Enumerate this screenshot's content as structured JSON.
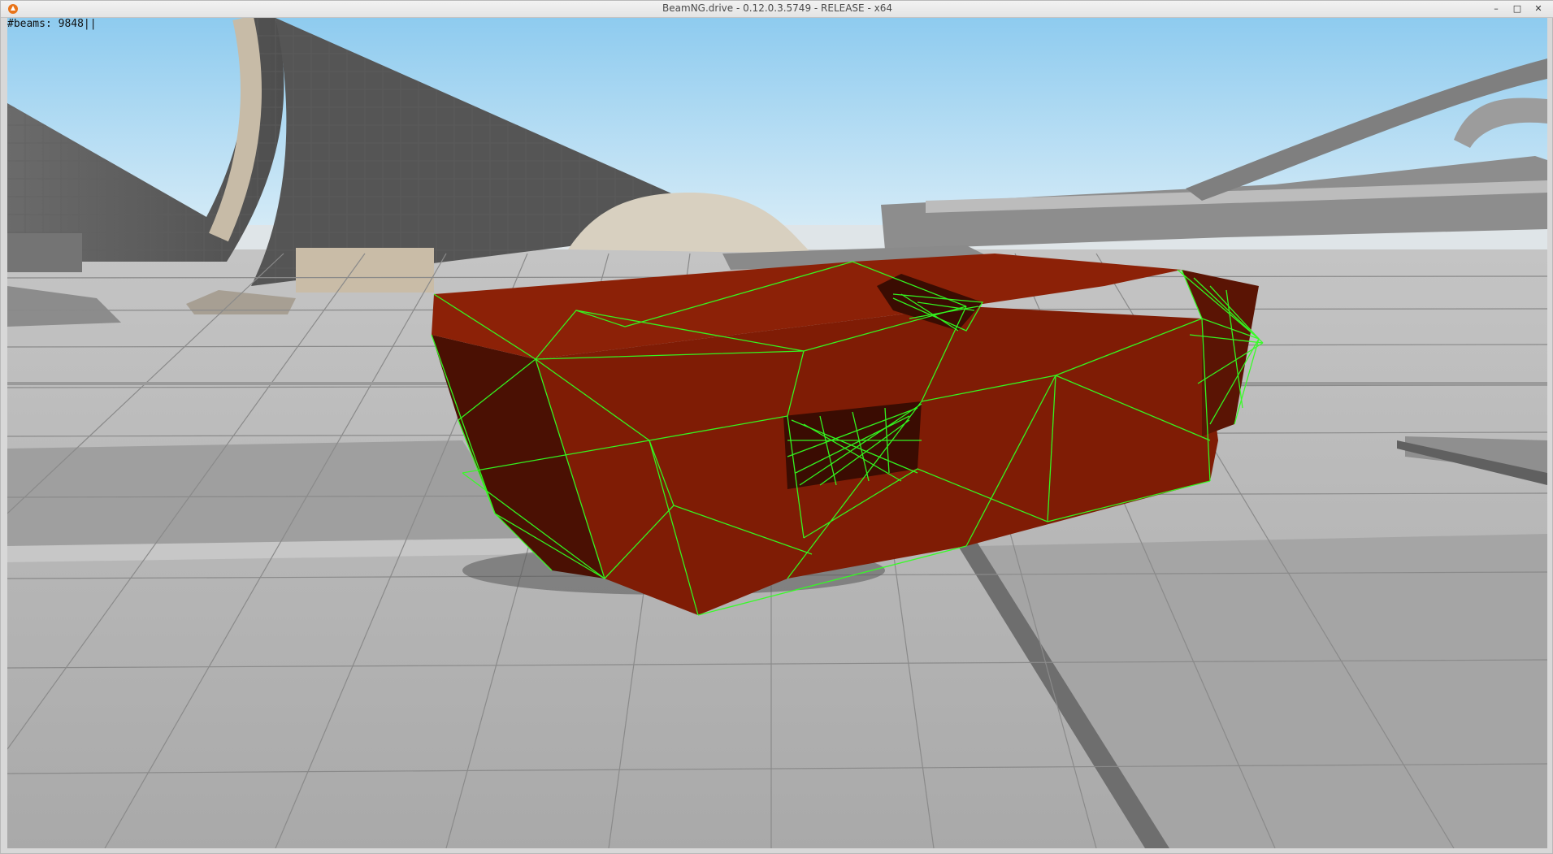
{
  "window": {
    "title": "BeamNG.drive - 0.12.0.3.5749 - RELEASE - x64",
    "controls": {
      "minimize": "–",
      "maximize": "□",
      "close": "✕"
    }
  },
  "debug": {
    "beams_label": "#beams: 9848||"
  },
  "colors": {
    "sky_top": "#9fd0f0",
    "sky_bottom": "#dbeef8",
    "ground": "#b9b9b9",
    "tile_line": "#7c7c7c",
    "car_body": "#7f1c05",
    "car_shadow": "#4a1003",
    "beam_wire": "#33ff22"
  },
  "icons": {
    "app": "beamng-logo-icon"
  }
}
